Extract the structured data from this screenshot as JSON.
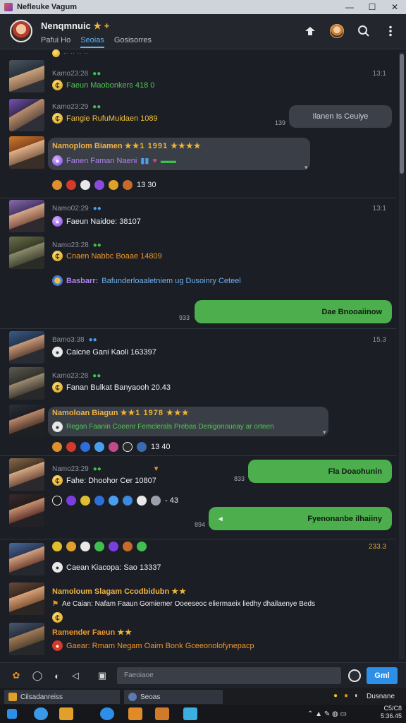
{
  "window": {
    "title": "Nefleuke Vagum",
    "controls": [
      "—",
      "☐",
      "✕"
    ]
  },
  "header": {
    "name": "Nenqmnuic",
    "name_suffix": "★ +",
    "tabs": [
      "Pafui Ho",
      "Seoias",
      "Gosisorres"
    ],
    "active_tab": 1,
    "icons": [
      "puzzle-icon",
      "user-avatar",
      "search-icon",
      "more-vertical-icon"
    ]
  },
  "messages": [
    {
      "meta": "Kamo23:28",
      "text": "Faeun Maobonkers 418 0",
      "time": "13:1"
    },
    {
      "meta": "Kamo23:29",
      "text": "Fangie RufuMuidaen 1089",
      "bubble_right": "Ilanen Is Ceuiye",
      "bubble_time": "139"
    },
    {
      "meta": "Namoplom Biamen",
      "stars": "★★1 1991 ★★★★",
      "text": "Fanen Faman Naeni",
      "reactions": "13 30"
    },
    {
      "meta": "Namo02:29",
      "text": "Faeun Naidoe: 38107",
      "time": "13:1"
    },
    {
      "meta": "Namo23:28",
      "text": "Cnaen Nabbc Boaae 14809"
    },
    {
      "meta": "Basbarr:",
      "text": "Bafunderloaaletniem ug Dusoinry Ceteel"
    },
    {
      "bubble_right": "Dae Bnooaiinow",
      "bubble_time": "933"
    },
    {
      "meta": "Bamo3:38",
      "text": "Caicne Gani Kaoli 163397",
      "time": "15.3"
    },
    {
      "meta": "Kamo23:28",
      "text": "Fanan Bulkat Banyaooh 20.43"
    },
    {
      "meta": "Namoloan Biagun",
      "stars": "★★1 1978 ★★★",
      "text": "Regan Faanin Coeenr Femclerals Prebas Denigonoueay ar orteen",
      "reactions": "13 40"
    },
    {
      "meta": "Namo23:29",
      "text": "Fahe: Dhoohor Cer 10807",
      "bubble_right": "Fla Doaohunin",
      "bubble_time": "833"
    },
    {
      "text": "- 43",
      "bubble_right": "Fyenonanbe ilhaiiny",
      "bubble_time": "894"
    },
    {
      "meta": "",
      "text": "Caean Kiacopa: Sao 13337",
      "time": "233.3"
    },
    {
      "meta": "Namoloum Slagam Ccodbidubn",
      "stars": "★★",
      "text": "Ae Caian: Nafam Faaun Gomiemer Ooeeseoc eliermaeix liedhy dhailaenye Beds"
    },
    {
      "meta": "Ramender Faeun",
      "stars": "★★",
      "text": "Gaear: Rmam Negam Oairn Bonk Gceeonolofynepacp"
    }
  ],
  "composer": {
    "placeholder": "Faeoiaoe",
    "send_label": "Gml"
  },
  "taskbar": {
    "tabs": [
      "Cilsadanreiss",
      "Seoas"
    ],
    "tray_text": "Dusnane",
    "clock_line1": "C5/C8",
    "clock_line2": "5:36.45"
  },
  "colors": {
    "accent": "#2d8fe8",
    "green_bubble": "#4cae4c",
    "background": "#1b1e24"
  }
}
